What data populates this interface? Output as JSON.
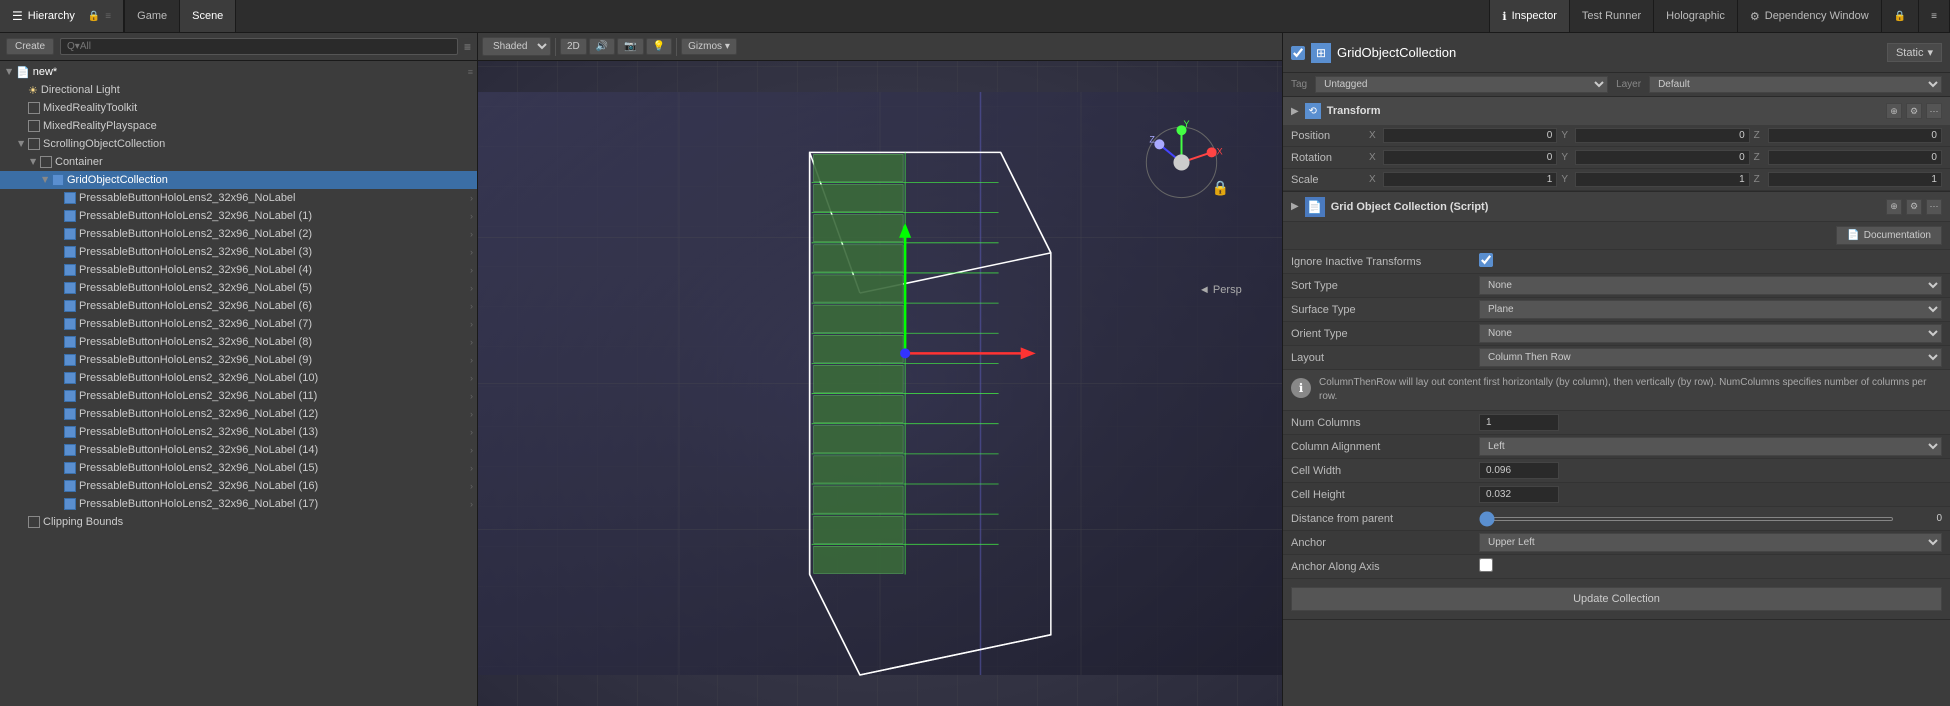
{
  "tabs": {
    "hierarchy": "Hierarchy",
    "game": "Game",
    "scene": "Scene",
    "inspector": "Inspector",
    "testRunner": "Test Runner",
    "holographic": "Holographic",
    "dependencyWindow": "Dependency Window"
  },
  "hierarchy": {
    "createLabel": "Create",
    "searchPlaceholder": "Q▾All",
    "items": [
      {
        "label": "new*",
        "indent": 0,
        "type": "root",
        "expanded": true
      },
      {
        "label": "Directional Light",
        "indent": 1,
        "type": "light"
      },
      {
        "label": "MixedRealityToolkit",
        "indent": 1,
        "type": "cube"
      },
      {
        "label": "MixedRealityPlayspace",
        "indent": 1,
        "type": "cube"
      },
      {
        "label": "ScrollingObjectCollection",
        "indent": 1,
        "type": "cube",
        "expanded": true
      },
      {
        "label": "Container",
        "indent": 2,
        "type": "cube",
        "expanded": true
      },
      {
        "label": "GridObjectCollection",
        "indent": 3,
        "type": "cube_blue",
        "expanded": true,
        "selected": true
      },
      {
        "label": "PressableButtonHoloLens2_32x96_NoLabel",
        "indent": 4,
        "type": "cube_blue",
        "highlighted": true
      },
      {
        "label": "PressableButtonHoloLens2_32x96_NoLabel (1)",
        "indent": 4,
        "type": "cube_blue",
        "highlighted": true
      },
      {
        "label": "PressableButtonHoloLens2_32x96_NoLabel (2)",
        "indent": 4,
        "type": "cube_blue",
        "highlighted": true
      },
      {
        "label": "PressableButtonHoloLens2_32x96_NoLabel (3)",
        "indent": 4,
        "type": "cube_blue",
        "highlighted": true
      },
      {
        "label": "PressableButtonHoloLens2_32x96_NoLabel (4)",
        "indent": 4,
        "type": "cube_blue",
        "highlighted": true
      },
      {
        "label": "PressableButtonHoloLens2_32x96_NoLabel (5)",
        "indent": 4,
        "type": "cube_blue",
        "highlighted": true
      },
      {
        "label": "PressableButtonHoloLens2_32x96_NoLabel (6)",
        "indent": 4,
        "type": "cube_blue",
        "highlighted": true
      },
      {
        "label": "PressableButtonHoloLens2_32x96_NoLabel (7)",
        "indent": 4,
        "type": "cube_blue",
        "highlighted": true
      },
      {
        "label": "PressableButtonHoloLens2_32x96_NoLabel (8)",
        "indent": 4,
        "type": "cube_blue",
        "highlighted": true
      },
      {
        "label": "PressableButtonHoloLens2_32x96_NoLabel (9)",
        "indent": 4,
        "type": "cube_blue",
        "highlighted": true
      },
      {
        "label": "PressableButtonHoloLens2_32x96_NoLabel (10)",
        "indent": 4,
        "type": "cube_blue",
        "highlighted": true
      },
      {
        "label": "PressableButtonHoloLens2_32x96_NoLabel (11)",
        "indent": 4,
        "type": "cube_blue",
        "highlighted": true
      },
      {
        "label": "PressableButtonHoloLens2_32x96_NoLabel (12)",
        "indent": 4,
        "type": "cube_blue",
        "highlighted": true
      },
      {
        "label": "PressableButtonHoloLens2_32x96_NoLabel (13)",
        "indent": 4,
        "type": "cube_blue",
        "highlighted": true
      },
      {
        "label": "PressableButtonHoloLens2_32x96_NoLabel (14)",
        "indent": 4,
        "type": "cube_blue",
        "highlighted": true
      },
      {
        "label": "PressableButtonHoloLens2_32x96_NoLabel (15)",
        "indent": 4,
        "type": "cube_blue",
        "highlighted": true
      },
      {
        "label": "PressableButtonHoloLens2_32x96_NoLabel (16)",
        "indent": 4,
        "type": "cube_blue",
        "highlighted": true
      },
      {
        "label": "PressableButtonHoloLens2_32x96_NoLabel (17)",
        "indent": 4,
        "type": "cube_blue",
        "highlighted": true
      },
      {
        "label": "Clipping Bounds",
        "indent": 1,
        "type": "cube"
      }
    ]
  },
  "scene": {
    "shaded": "Shaded",
    "twod": "2D",
    "persp": "Persp",
    "gizmos": "Gizmos"
  },
  "inspector": {
    "objectName": "GridObjectCollection",
    "staticLabel": "Static",
    "tag": "Untagged",
    "layer": "Default",
    "transform": {
      "title": "Transform",
      "position": {
        "label": "Position",
        "x": "0",
        "y": "0",
        "z": "0"
      },
      "rotation": {
        "label": "Rotation",
        "x": "0",
        "y": "0",
        "z": "0"
      },
      "scale": {
        "label": "Scale",
        "x": "1",
        "y": "1",
        "z": "1"
      }
    },
    "script": {
      "title": "Grid Object Collection (Script)",
      "docButton": "Documentation",
      "props": {
        "ignoreInactiveTransforms": {
          "label": "Ignore Inactive Transforms",
          "checked": true
        },
        "sortType": {
          "label": "Sort Type",
          "value": "None"
        },
        "surfaceType": {
          "label": "Surface Type",
          "value": "Plane"
        },
        "orientType": {
          "label": "Orient Type",
          "value": "None"
        },
        "layout": {
          "label": "Layout",
          "value": "Column Then Row"
        },
        "infoText": "ColumnThenRow will lay out content first horizontally (by column), then vertically (by row). NumColumns specifies number of columns per row.",
        "numColumns": {
          "label": "Num Columns",
          "value": "1"
        },
        "columnAlignment": {
          "label": "Column Alignment",
          "value": "Left"
        },
        "cellWidth": {
          "label": "Cell Width",
          "value": "0.096"
        },
        "cellHeight": {
          "label": "Cell Height",
          "value": "0.032"
        },
        "distanceFromParent": {
          "label": "Distance from parent",
          "sliderValue": "0",
          "inputValue": "0"
        },
        "anchor": {
          "label": "Anchor",
          "value": "Upper Left"
        },
        "anchorAlongAxis": {
          "label": "Anchor Along Axis",
          "checked": false
        },
        "updateCollection": "Update Collection"
      }
    }
  }
}
